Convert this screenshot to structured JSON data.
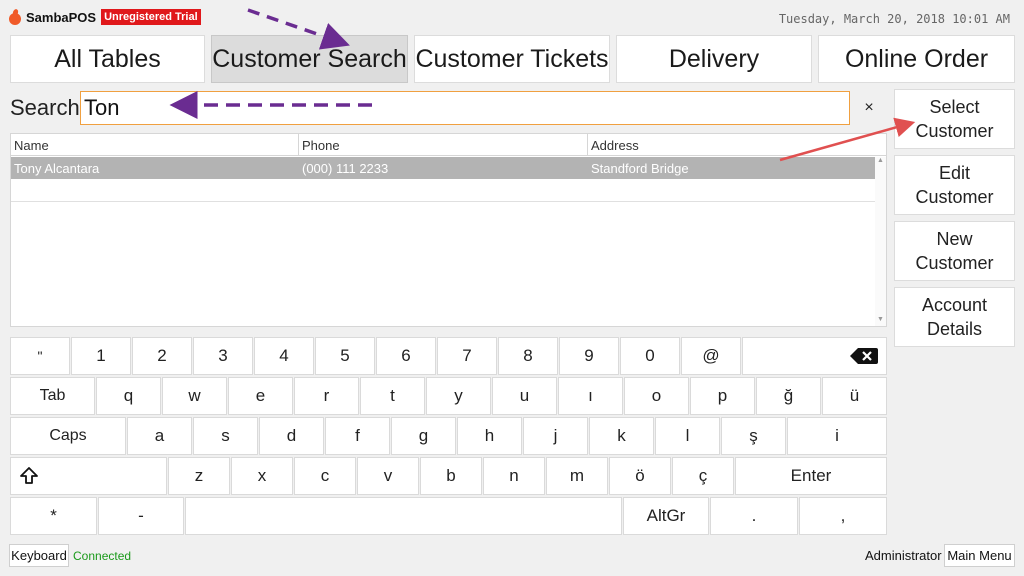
{
  "app": {
    "logo_text": "SambaPOS",
    "trial_badge": "Unregistered Trial",
    "datetime": "Tuesday, March 20, 2018 10:01 AM"
  },
  "tabs": [
    {
      "label": "All Tables",
      "active": false
    },
    {
      "label": "Customer Search",
      "active": true
    },
    {
      "label": "Customer Tickets",
      "active": false
    },
    {
      "label": "Delivery",
      "active": false
    },
    {
      "label": "Online Order",
      "active": false
    }
  ],
  "search": {
    "label": "Search",
    "value": "Ton",
    "clear_icon": "×"
  },
  "table": {
    "columns": [
      "Name",
      "Phone",
      "Address"
    ],
    "rows": [
      {
        "name": "Tony Alcantara",
        "phone": "(000) 111 2233",
        "address": "Standford Bridge",
        "selected": true
      }
    ]
  },
  "side_buttons": [
    {
      "line1": "Select",
      "line2": "Customer"
    },
    {
      "line1": "Edit",
      "line2": "Customer"
    },
    {
      "line1": "New",
      "line2": "Customer"
    },
    {
      "line1": "Account",
      "line2": "Details"
    }
  ],
  "keyboard": {
    "row1": [
      "\"",
      "1",
      "2",
      "3",
      "4",
      "5",
      "6",
      "7",
      "8",
      "9",
      "0",
      "@"
    ],
    "row2": [
      "Tab",
      "q",
      "w",
      "e",
      "r",
      "t",
      "y",
      "u",
      "ı",
      "o",
      "p",
      "ğ",
      "ü"
    ],
    "row3": [
      "Caps",
      "a",
      "s",
      "d",
      "f",
      "g",
      "h",
      "j",
      "k",
      "l",
      "ş",
      "i"
    ],
    "row4": [
      "z",
      "x",
      "c",
      "v",
      "b",
      "n",
      "m",
      "ö",
      "ç",
      "Enter"
    ],
    "row5": [
      "*",
      "-",
      "AltGr",
      ".",
      ","
    ]
  },
  "footer": {
    "keyboard_button": "Keyboard",
    "status": "Connected",
    "user": "Administrator",
    "main_menu": "Main Menu"
  },
  "colors": {
    "accent_red": "#e0181b",
    "status_green": "#1a9a1a",
    "arrow_purple": "#6a2c91",
    "arrow_red": "#e05050"
  }
}
